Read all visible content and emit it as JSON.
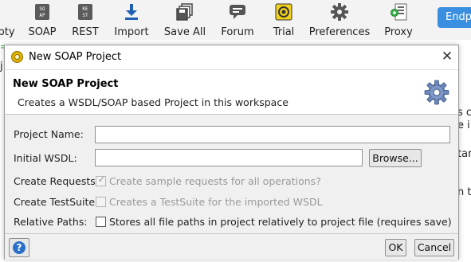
{
  "toolbar": {
    "items": [
      {
        "label": "pty",
        "icon": "empty-project-icon"
      },
      {
        "label": "SOAP",
        "icon": "soap-icon"
      },
      {
        "label": "REST",
        "icon": "rest-icon"
      },
      {
        "label": "Import",
        "icon": "import-icon"
      },
      {
        "label": "Save All",
        "icon": "save-all-icon"
      },
      {
        "label": "Forum",
        "icon": "forum-icon"
      },
      {
        "label": "Trial",
        "icon": "trial-icon"
      },
      {
        "label": "Preferences",
        "icon": "gear-icon"
      },
      {
        "label": "Proxy",
        "icon": "proxy-icon"
      }
    ],
    "endpoint_label": "Endp",
    "soap_icon_text": "SO\nAP",
    "rest_icon_text": "RE\nST"
  },
  "background": {
    "fragments": [
      "s c",
      "e i",
      "tar",
      "n to"
    ],
    "left_fragments": [
      "=",
      "j"
    ]
  },
  "dialog": {
    "title": "New SOAP Project",
    "header_title": "New SOAP Project",
    "header_description": "Creates a WSDL/SOAP based Project in this workspace",
    "fields": {
      "project_name_label": "Project Name:",
      "project_name_value": "",
      "initial_wsdl_label": "Initial WSDL:",
      "initial_wsdl_value": "",
      "browse_label": "Browse...",
      "create_requests_label": "Create Requests:",
      "create_requests_text": "Create sample requests for all operations?",
      "create_requests_checked": true,
      "create_testsuite_label": "Create TestSuite:",
      "create_testsuite_text": "Creates a TestSuite for the imported WSDL",
      "create_testsuite_checked": false,
      "relative_paths_label": "Relative Paths:",
      "relative_paths_text": "Stores all file paths in project relatively to project file (requires save)",
      "relative_paths_checked": false
    },
    "buttons": {
      "ok": "OK",
      "cancel": "Cancel",
      "help_glyph": "?"
    },
    "close_glyph": "✕"
  },
  "colors": {
    "accent_blue": "#3a8fe0",
    "dialog_bg": "#f0f0f0",
    "disabled_text": "#9a9a9a"
  }
}
